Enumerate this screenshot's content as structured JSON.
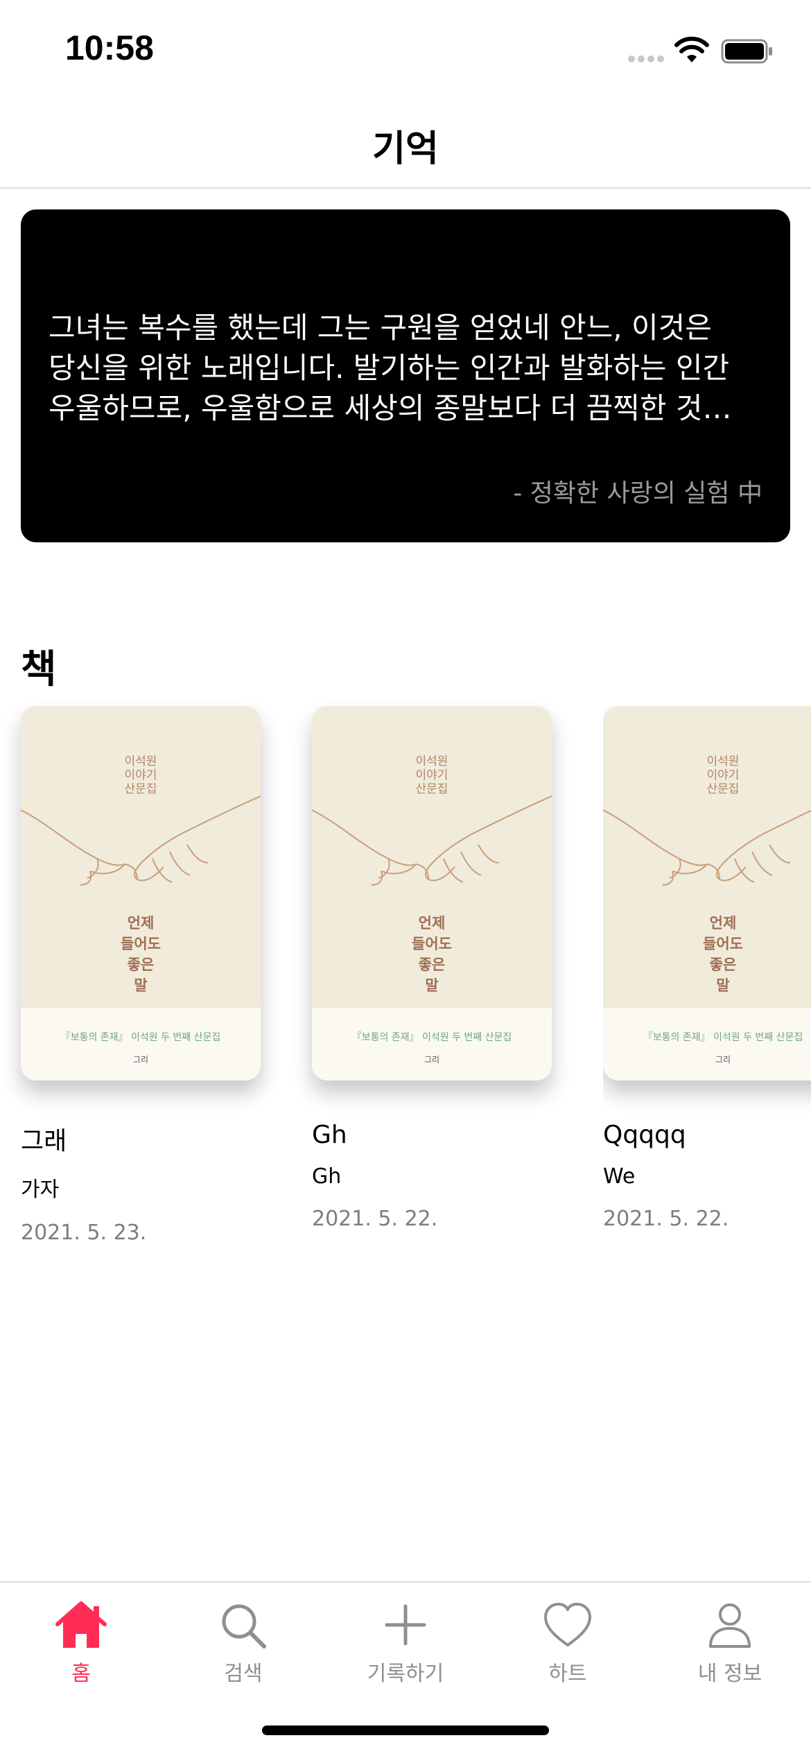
{
  "status_bar": {
    "time": "10:58"
  },
  "nav": {
    "title": "기억"
  },
  "quote": {
    "text": "그녀는 복수를 했는데 그는 구원을 얻었네 안느, 이것은 당신을 위한 노래입니다. 발기하는 인간과 발화하는 인간 우울하므로, 우울함으로 세상의 종말보다 더 끔찍한 것…",
    "source": "- 정확한 사랑의 실험 中"
  },
  "books_section": {
    "title": "책",
    "books": [
      {
        "title": "그래",
        "author": "가자",
        "date": "2021. 5. 23."
      },
      {
        "title": "Gh",
        "author": "Gh",
        "date": "2021. 5. 22."
      },
      {
        "title": "Qqqqq",
        "author": "We",
        "date": "2021. 5. 22."
      }
    ],
    "cover": {
      "top_text": [
        "이석원",
        "이야기",
        "산문집"
      ],
      "main_title": [
        "언제",
        "들어도",
        "좋은",
        "말"
      ],
      "bottom_line": "『보통의 존재』 이석원 두 번째 산문집",
      "publisher_mark": "그리"
    }
  },
  "tab_bar": {
    "items": [
      {
        "label": "홈",
        "icon": "house-icon",
        "active": true
      },
      {
        "label": "검색",
        "icon": "magnifier-icon",
        "active": false
      },
      {
        "label": "기록하기",
        "icon": "plus-icon",
        "active": false
      },
      {
        "label": "하트",
        "icon": "heart-icon",
        "active": false
      },
      {
        "label": "내 정보",
        "icon": "person-icon",
        "active": false
      }
    ]
  },
  "colors": {
    "accent": "#ff2d55",
    "inactive_tab": "#8e8e93",
    "quote_background": "#000000",
    "cover_background": "#f1ebdb"
  }
}
